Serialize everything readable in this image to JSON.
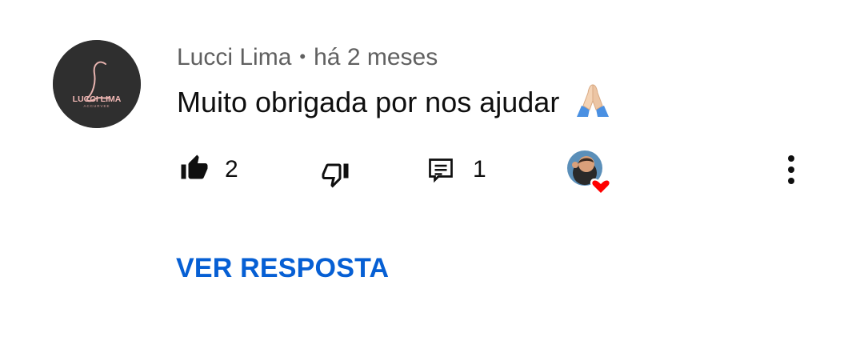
{
  "comment": {
    "author_avatar_text": "LUCCI LIMA",
    "author_avatar_subtext": "ACCURVEE",
    "author_name": "Lucci Lima",
    "separator": "•",
    "timestamp": "há 2 meses",
    "text": "Muito obrigada por nos ajudar",
    "emoji": "praying-hands-emoji"
  },
  "actions": {
    "like_count": "2",
    "reply_count": "1",
    "like_icon": "thumb-up-filled-icon",
    "dislike_icon": "thumb-down-icon",
    "reply_icon": "comment-icon",
    "creator_heart_icon": "heart-icon",
    "more_icon": "more-vertical-icon"
  },
  "replies": {
    "view_label": "VER RESPOSTA"
  },
  "colors": {
    "link": "#065fd4",
    "secondary_text": "#606060",
    "primary_text": "#0f0f0f",
    "heart": "#ff0000"
  }
}
